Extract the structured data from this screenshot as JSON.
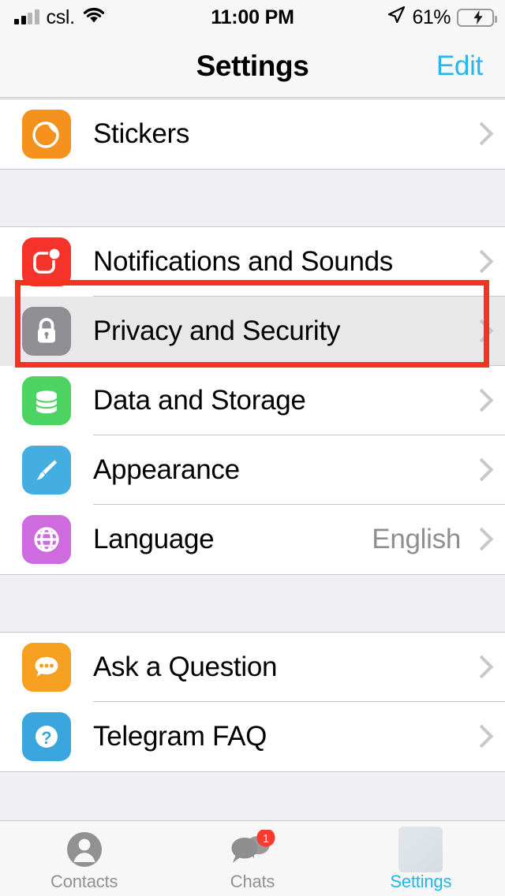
{
  "status_bar": {
    "carrier": "csl.",
    "time": "11:00 PM",
    "battery_percent": "61%",
    "battery_level": 62,
    "wifi_icon": "wifi-icon",
    "location_icon": "location-arrow-icon",
    "signal_icon": "signal-bars-icon",
    "battery_icon": "battery-charging-icon"
  },
  "nav": {
    "title": "Settings",
    "edit_label": "Edit"
  },
  "colors": {
    "accent": "#29B6E8",
    "annotation": "#F4331C",
    "badge": "#FC3A2D",
    "separator": "#C8C7CC",
    "group_bg": "#EFEFF4",
    "value_text": "#8E8E93"
  },
  "sections": [
    {
      "name": "stickers-section",
      "rows": [
        {
          "label": "Stickers",
          "value": "",
          "icon": "sticker-icon",
          "icon_color": "#F5921E",
          "chevron": true,
          "highlighted": false
        }
      ]
    },
    {
      "name": "preferences-section",
      "rows": [
        {
          "label": "Notifications and Sounds",
          "value": "",
          "icon": "notifications-icon",
          "icon_color": "#F5332B",
          "chevron": true,
          "highlighted": false
        },
        {
          "label": "Privacy and Security",
          "value": "",
          "icon": "lock-icon",
          "icon_color": "#8E8E93",
          "chevron": true,
          "highlighted": true
        },
        {
          "label": "Data and Storage",
          "value": "",
          "icon": "database-icon",
          "icon_color": "#4CD362",
          "chevron": true,
          "highlighted": false
        },
        {
          "label": "Appearance",
          "value": "",
          "icon": "paintbrush-icon",
          "icon_color": "#44AEE1",
          "chevron": true,
          "highlighted": false
        },
        {
          "label": "Language",
          "value": "English",
          "icon": "globe-icon",
          "icon_color": "#CE6BDE",
          "chevron": true,
          "highlighted": false
        }
      ]
    },
    {
      "name": "help-section",
      "rows": [
        {
          "label": "Ask a Question",
          "value": "",
          "icon": "chat-bubble-icon",
          "icon_color": "#F5A021",
          "chevron": true,
          "highlighted": false
        },
        {
          "label": "Telegram FAQ",
          "value": "",
          "icon": "question-mark-icon",
          "icon_color": "#3BA6DE",
          "chevron": true,
          "highlighted": false
        }
      ]
    }
  ],
  "tabs": [
    {
      "label": "Contacts",
      "icon": "contacts-person-icon",
      "badge": "",
      "active": false
    },
    {
      "label": "Chats",
      "icon": "chats-bubbles-icon",
      "badge": "1",
      "active": false
    },
    {
      "label": "Settings",
      "icon": "settings-placeholder-icon",
      "badge": "",
      "active": true
    }
  ],
  "annotation": {
    "target": "Privacy and Security",
    "shape": "rectangle",
    "color": "#F4331C"
  }
}
